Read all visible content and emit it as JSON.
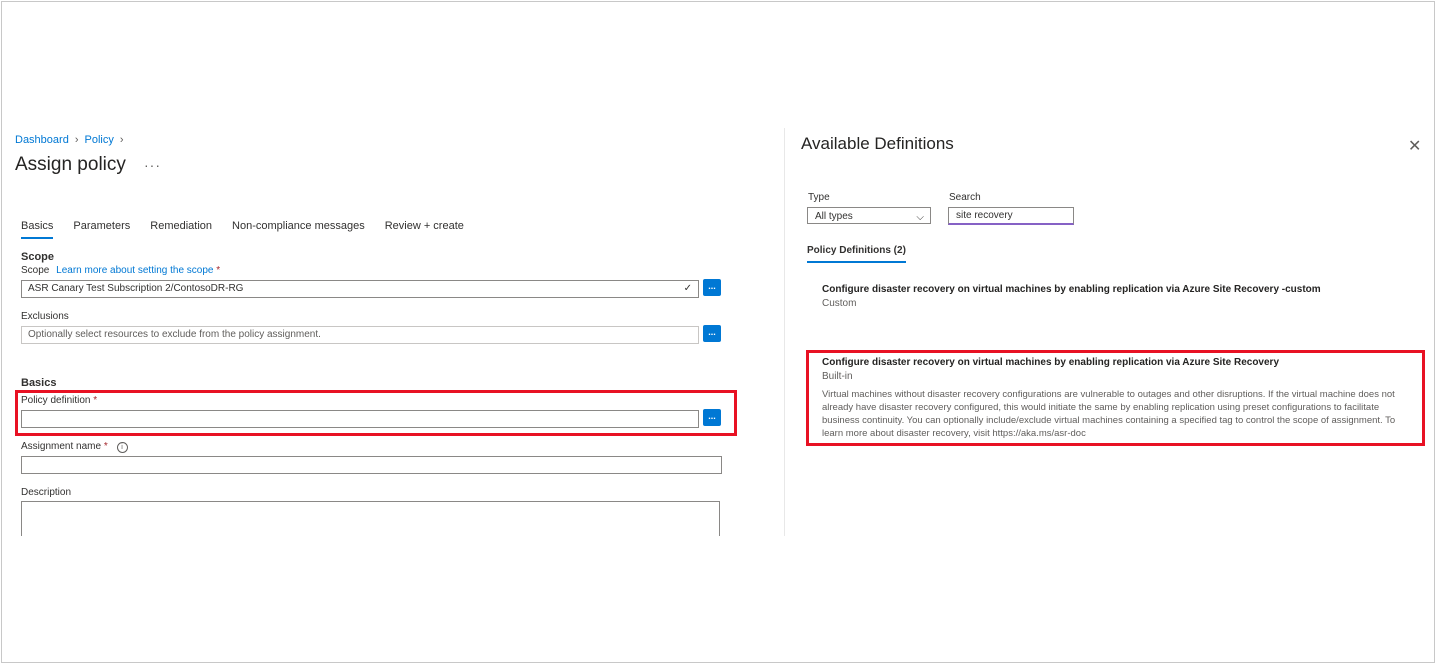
{
  "breadcrumb": {
    "items": [
      "Dashboard",
      "Policy"
    ]
  },
  "page": {
    "title": "Assign policy",
    "more": "···"
  },
  "tabs": [
    "Basics",
    "Parameters",
    "Remediation",
    "Non-compliance messages",
    "Review + create"
  ],
  "scope": {
    "section": "Scope",
    "label": "Scope",
    "learn_more": "Learn more about setting the scope",
    "value": "ASR Canary Test Subscription 2/ContosoDR-RG",
    "exclusions_label": "Exclusions",
    "exclusions_placeholder": "Optionally select resources to exclude from the policy assignment."
  },
  "basics": {
    "section": "Basics",
    "policy_definition_label": "Policy definition",
    "assignment_name_label": "Assignment name",
    "description_label": "Description"
  },
  "browse_label": "...",
  "required_mark": "*",
  "panel": {
    "title": "Available Definitions",
    "type_label": "Type",
    "type_value": "All types",
    "search_label": "Search",
    "search_value": "site recovery",
    "results_tab": "Policy Definitions (2)",
    "definitions": [
      {
        "name": "Configure disaster recovery on virtual machines by enabling replication via Azure Site Recovery -custom",
        "type": "Custom"
      },
      {
        "name": "Configure disaster recovery on virtual machines by enabling replication via Azure Site Recovery",
        "type": "Built-in",
        "description": "Virtual machines without disaster recovery configurations are vulnerable to outages and other disruptions. If the virtual machine does not already have disaster recovery configured, this would initiate the same by enabling replication using preset configurations to facilitate business continuity.  You can optionally include/exclude virtual machines containing a specified tag to control the scope of assignment. To learn more about disaster recovery, visit https://aka.ms/asr-doc"
      }
    ]
  },
  "colors": {
    "accent": "#0078d4",
    "highlight": "#e81123",
    "search_focus": "#8661c5"
  }
}
